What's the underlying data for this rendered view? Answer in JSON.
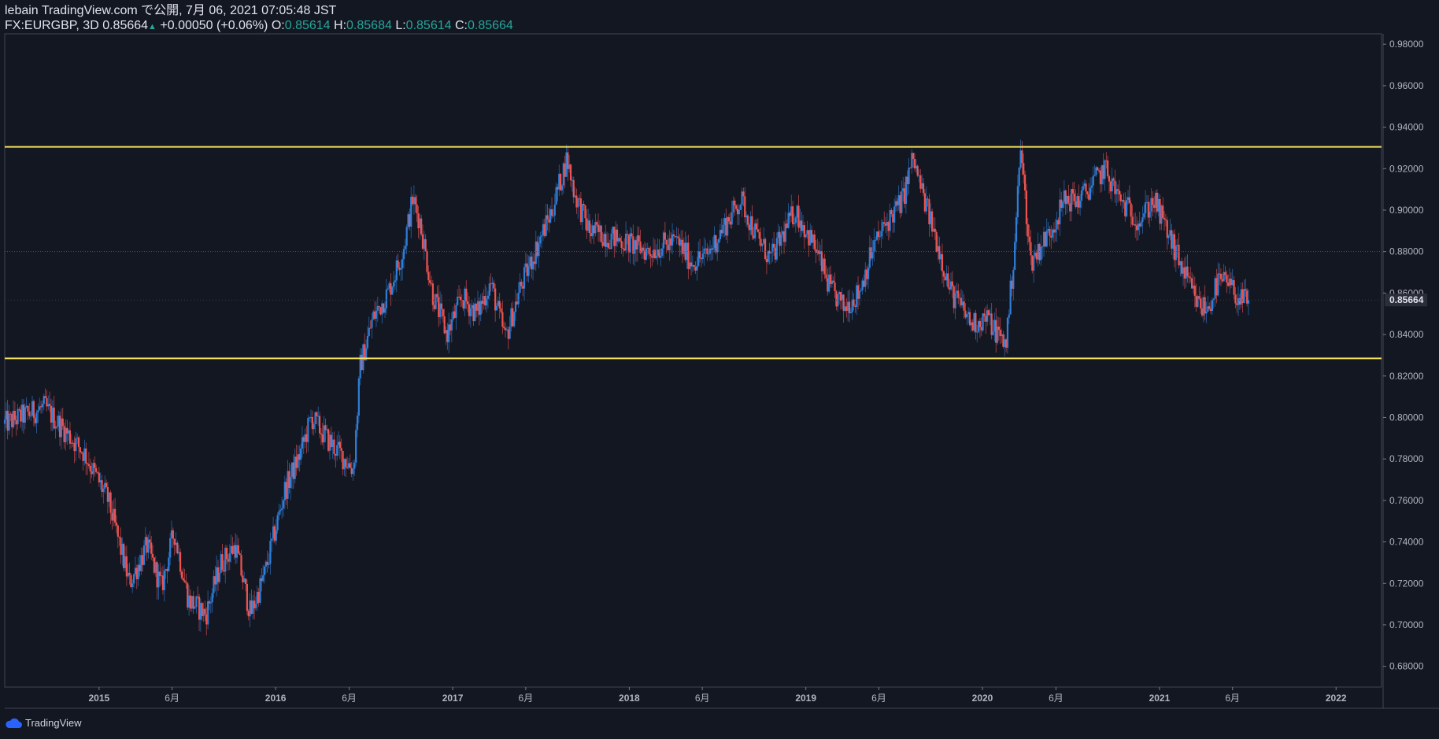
{
  "header": {
    "line1": "lebain TradingView.com で公開, 7月 06, 2021 07:05:48 JST",
    "symbol": "FX:EURGBP, 3D",
    "last": "0.85664",
    "arrow": "▲",
    "change": "+0.00050 (+0.06%)",
    "o_label": "O:",
    "o_value": "0.85614",
    "h_label": "H:",
    "h_value": "0.85684",
    "l_label": "L:",
    "l_value": "0.85614",
    "c_label": "C:",
    "c_value": "0.85664"
  },
  "brand": {
    "label": "TradingView"
  },
  "chart_data": {
    "type": "candlestick",
    "symbol": "FX:EURGBP",
    "interval": "3D",
    "ylim": [
      0.67,
      0.985
    ],
    "y_ticks": [
      "0.68000",
      "0.70000",
      "0.72000",
      "0.74000",
      "0.76000",
      "0.78000",
      "0.80000",
      "0.82000",
      "0.84000",
      "0.86000",
      "0.88000",
      "0.90000",
      "0.92000",
      "0.94000",
      "0.96000",
      "0.98000"
    ],
    "x_ticks": [
      {
        "label": "2015",
        "date": "2015-01-01",
        "bold": true
      },
      {
        "label": "6月",
        "date": "2015-06-01",
        "bold": false
      },
      {
        "label": "2016",
        "date": "2016-01-01",
        "bold": true
      },
      {
        "label": "6月",
        "date": "2016-06-01",
        "bold": false
      },
      {
        "label": "2017",
        "date": "2017-01-01",
        "bold": true
      },
      {
        "label": "6月",
        "date": "2017-06-01",
        "bold": false
      },
      {
        "label": "2018",
        "date": "2018-01-01",
        "bold": true
      },
      {
        "label": "6月",
        "date": "2018-06-01",
        "bold": false
      },
      {
        "label": "2019",
        "date": "2019-01-01",
        "bold": true
      },
      {
        "label": "6月",
        "date": "2019-06-01",
        "bold": false
      },
      {
        "label": "2020",
        "date": "2020-01-01",
        "bold": true
      },
      {
        "label": "6月",
        "date": "2020-06-01",
        "bold": false
      },
      {
        "label": "2021",
        "date": "2021-01-01",
        "bold": true
      },
      {
        "label": "6月",
        "date": "2021-06-01",
        "bold": false
      },
      {
        "label": "2022",
        "date": "2022-01-01",
        "bold": true
      }
    ],
    "xlim": [
      "2014-06-20",
      "2022-04-05"
    ],
    "price_path": [
      [
        "2014-06-20",
        0.797
      ],
      [
        "2014-09-10",
        0.805
      ],
      [
        "2014-12-01",
        0.783
      ],
      [
        "2015-01-20",
        0.76
      ],
      [
        "2015-03-05",
        0.72
      ],
      [
        "2015-04-10",
        0.738
      ],
      [
        "2015-05-10",
        0.718
      ],
      [
        "2015-06-05",
        0.745
      ],
      [
        "2015-07-05",
        0.712
      ],
      [
        "2015-08-10",
        0.705
      ],
      [
        "2015-09-10",
        0.73
      ],
      [
        "2015-10-10",
        0.738
      ],
      [
        "2015-11-10",
        0.705
      ],
      [
        "2015-12-10",
        0.725
      ],
      [
        "2016-01-20",
        0.765
      ],
      [
        "2016-02-20",
        0.782
      ],
      [
        "2016-03-15",
        0.8
      ],
      [
        "2016-04-15",
        0.79
      ],
      [
        "2016-06-10",
        0.775
      ],
      [
        "2016-06-24",
        0.825
      ],
      [
        "2016-07-20",
        0.848
      ],
      [
        "2016-08-20",
        0.86
      ],
      [
        "2016-09-20",
        0.88
      ],
      [
        "2016-10-10",
        0.905
      ],
      [
        "2016-10-25",
        0.895
      ],
      [
        "2016-11-20",
        0.86
      ],
      [
        "2016-12-20",
        0.84
      ],
      [
        "2017-01-20",
        0.858
      ],
      [
        "2017-02-20",
        0.85
      ],
      [
        "2017-03-20",
        0.865
      ],
      [
        "2017-04-20",
        0.838
      ],
      [
        "2017-05-20",
        0.862
      ],
      [
        "2017-06-20",
        0.88
      ],
      [
        "2017-07-25",
        0.9
      ],
      [
        "2017-08-25",
        0.925
      ],
      [
        "2017-09-10",
        0.908
      ],
      [
        "2017-10-10",
        0.89
      ],
      [
        "2017-11-10",
        0.888
      ],
      [
        "2017-12-20",
        0.885
      ],
      [
        "2018-02-10",
        0.88
      ],
      [
        "2018-03-10",
        0.883
      ],
      [
        "2018-04-10",
        0.885
      ],
      [
        "2018-05-10",
        0.875
      ],
      [
        "2018-06-10",
        0.878
      ],
      [
        "2018-07-10",
        0.89
      ],
      [
        "2018-08-20",
        0.905
      ],
      [
        "2018-09-20",
        0.888
      ],
      [
        "2018-10-20",
        0.876
      ],
      [
        "2018-12-10",
        0.9
      ],
      [
        "2019-01-20",
        0.882
      ],
      [
        "2019-02-20",
        0.862
      ],
      [
        "2019-03-20",
        0.853
      ],
      [
        "2019-04-20",
        0.86
      ],
      [
        "2019-05-20",
        0.882
      ],
      [
        "2019-06-20",
        0.895
      ],
      [
        "2019-07-20",
        0.905
      ],
      [
        "2019-08-10",
        0.925
      ],
      [
        "2019-08-30",
        0.908
      ],
      [
        "2019-10-05",
        0.88
      ],
      [
        "2019-10-25",
        0.862
      ],
      [
        "2019-12-10",
        0.845
      ],
      [
        "2020-01-10",
        0.848
      ],
      [
        "2020-02-18",
        0.835
      ],
      [
        "2020-03-05",
        0.875
      ],
      [
        "2020-03-20",
        0.93
      ],
      [
        "2020-04-10",
        0.875
      ],
      [
        "2020-05-20",
        0.89
      ],
      [
        "2020-06-20",
        0.905
      ],
      [
        "2020-07-20",
        0.905
      ],
      [
        "2020-09-10",
        0.92
      ],
      [
        "2020-10-10",
        0.905
      ],
      [
        "2020-11-20",
        0.895
      ],
      [
        "2020-12-20",
        0.905
      ],
      [
        "2021-01-20",
        0.888
      ],
      [
        "2021-02-20",
        0.87
      ],
      [
        "2021-03-20",
        0.855
      ],
      [
        "2021-04-10",
        0.852
      ],
      [
        "2021-05-01",
        0.865
      ],
      [
        "2021-05-20",
        0.865
      ],
      [
        "2021-06-20",
        0.856
      ],
      [
        "2021-07-06",
        0.85664
      ]
    ],
    "support_line": 0.8285,
    "resistance_line": 0.9305,
    "last_price": 0.85664,
    "last_price_label": "0.85664",
    "colors": {
      "up": "#2e7fd9",
      "down": "#ef5350",
      "background": "#131722",
      "lines": "#f5e15a",
      "grid": "#2a2e39",
      "dotted": "#7a4a3a"
    }
  }
}
